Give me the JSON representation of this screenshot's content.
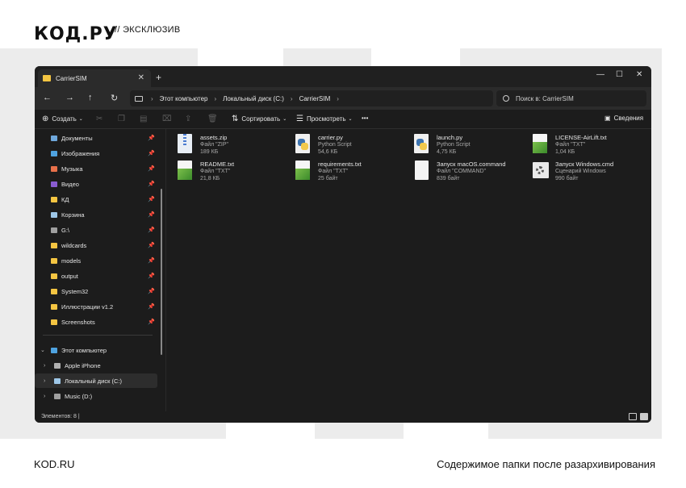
{
  "brand": {
    "logo": "КОД.РУ",
    "tagline": "//  ЭКСКЛЮЗИВ"
  },
  "footer": {
    "left": "KOD.RU",
    "right": "Содержимое папки после разархивирования"
  },
  "window": {
    "tab_title": "CarrierSIM",
    "tab_close": "✕",
    "new_tab": "+",
    "controls": {
      "minimize": "—",
      "maximize": "☐",
      "close": "✕"
    },
    "nav": {
      "back": "←",
      "forward": "→",
      "up": "↑",
      "refresh": "↻"
    },
    "breadcrumb": [
      "Этот компьютер",
      "Локальный диск (C:)",
      "CarrierSIM"
    ],
    "search_placeholder": "Поиск в: CarrierSIM",
    "toolbar": {
      "create": "Создать",
      "sort": "Сортировать",
      "view": "Просмотреть",
      "more": "•••",
      "details": "Сведения"
    },
    "sidebar": {
      "pinned": [
        {
          "label": "Документы",
          "icon": "documents-icon",
          "color": "#6fa8dc"
        },
        {
          "label": "Изображения",
          "icon": "pictures-icon",
          "color": "#4fa3e0"
        },
        {
          "label": "Музыка",
          "icon": "music-icon",
          "color": "#e8704a"
        },
        {
          "label": "Видео",
          "icon": "video-icon",
          "color": "#8a5cd1"
        },
        {
          "label": "КД",
          "icon": "folder-icon",
          "color": "#f4c542"
        },
        {
          "label": "Корзина",
          "icon": "recycle-bin-icon",
          "color": "#9ec7e8"
        },
        {
          "label": "G:\\",
          "icon": "drive-icon",
          "color": "#a0a0a0"
        },
        {
          "label": "wildcards",
          "icon": "folder-icon",
          "color": "#f4c542"
        },
        {
          "label": "models",
          "icon": "folder-icon",
          "color": "#f4c542"
        },
        {
          "label": "output",
          "icon": "folder-icon",
          "color": "#f4c542"
        },
        {
          "label": "System32",
          "icon": "folder-icon",
          "color": "#f4c542"
        },
        {
          "label": "Иллюстрации v1.2",
          "icon": "folder-icon",
          "color": "#f4c542"
        },
        {
          "label": "Screenshots",
          "icon": "folder-icon",
          "color": "#f4c542"
        }
      ],
      "tree": [
        {
          "label": "Этот компьютер",
          "icon": "computer-icon",
          "color": "#4fa3e0",
          "expander": "⌄"
        },
        {
          "label": "Apple iPhone",
          "icon": "phone-icon",
          "color": "#b0b0b0",
          "expander": "›"
        },
        {
          "label": "Локальный диск (C:)",
          "icon": "drive-icon",
          "color": "#9ec7e8",
          "expander": "›"
        },
        {
          "label": "Music (D:)",
          "icon": "drive-icon",
          "color": "#a0a0a0",
          "expander": "›"
        }
      ]
    },
    "files": [
      {
        "name": "assets.zip",
        "type": "Файл \"ZIP\"",
        "size": "189 КБ",
        "icon": "zip-file-icon"
      },
      {
        "name": "carrier.py",
        "type": "Python Script",
        "size": "54,6 КБ",
        "icon": "python-file-icon"
      },
      {
        "name": "launch.py",
        "type": "Python Script",
        "size": "4,75 КБ",
        "icon": "python-file-icon"
      },
      {
        "name": "LICENSE-AirLift.txt",
        "type": "Файл \"TXT\"",
        "size": "1,04 КБ",
        "icon": "text-file-icon"
      },
      {
        "name": "README.txt",
        "type": "Файл \"TXT\"",
        "size": "21,8 КБ",
        "icon": "text-file-icon"
      },
      {
        "name": "requirements.txt",
        "type": "Файл \"TXT\"",
        "size": "25 байт",
        "icon": "text-file-icon"
      },
      {
        "name": "Запуск macOS.command",
        "type": "Файл \"COMMAND\"",
        "size": "839 байт",
        "icon": "blank-file-icon"
      },
      {
        "name": "Запуск Windows.cmd",
        "type": "Сценарий Windows",
        "size": "990 байт",
        "icon": "script-file-icon"
      }
    ],
    "status": "Элементов: 8  |"
  }
}
